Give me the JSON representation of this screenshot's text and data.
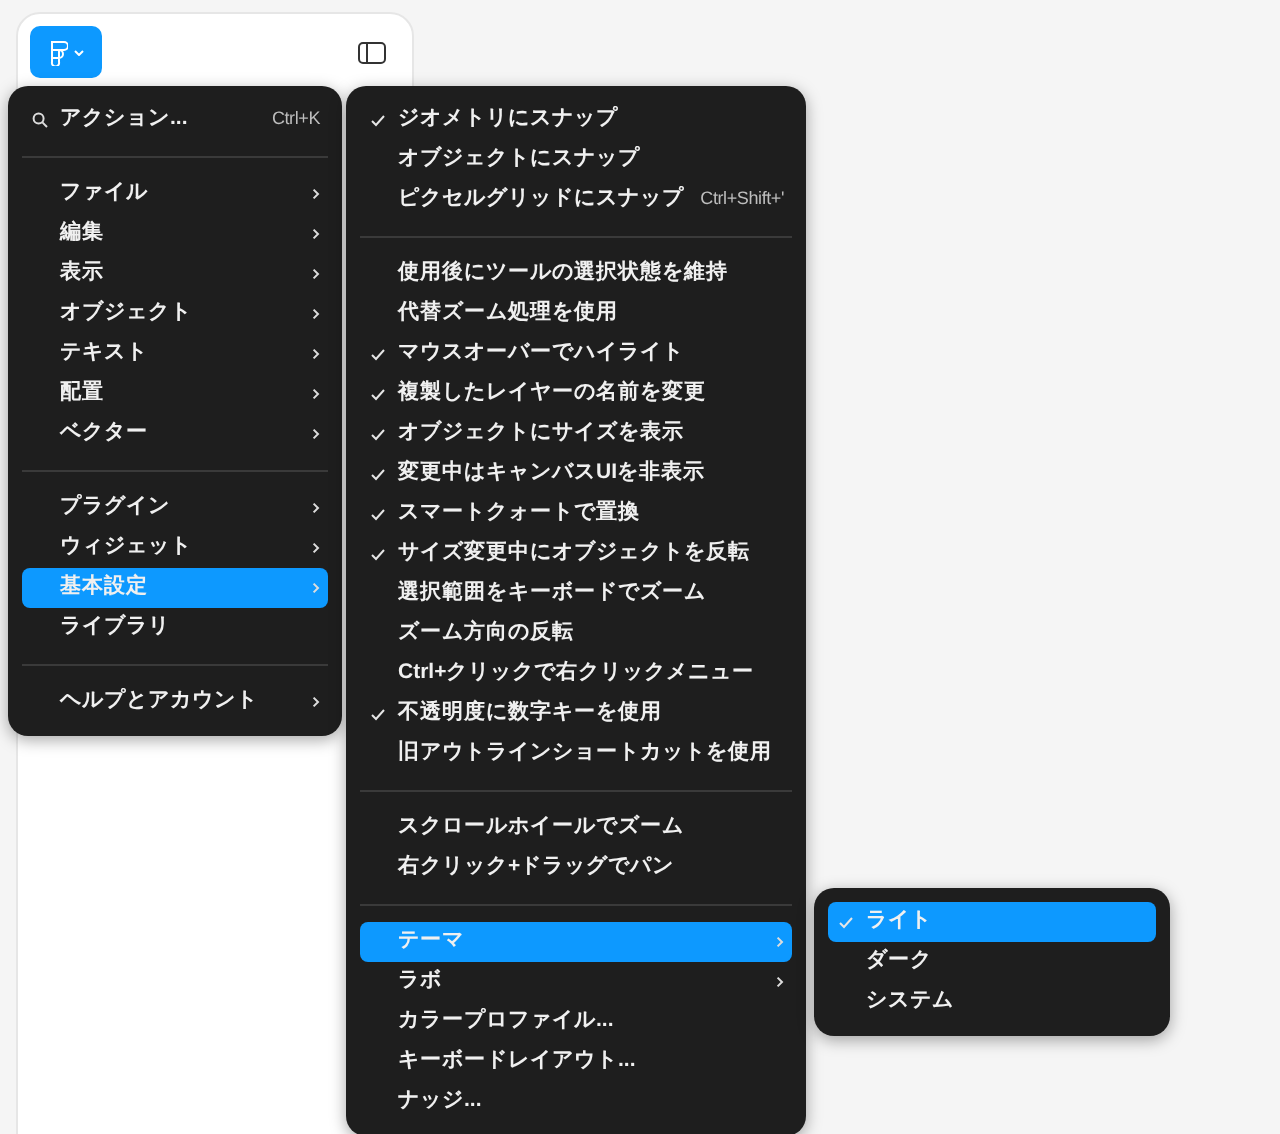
{
  "main_menu": {
    "sections": [
      {
        "items": [
          {
            "kind": "search",
            "label": "アクション...",
            "shortcut": "Ctrl+K",
            "has_submenu": false,
            "selected": false
          }
        ]
      },
      {
        "items": [
          {
            "kind": "item",
            "label": "ファイル",
            "has_submenu": true,
            "selected": false
          },
          {
            "kind": "item",
            "label": "編集",
            "has_submenu": true,
            "selected": false
          },
          {
            "kind": "item",
            "label": "表示",
            "has_submenu": true,
            "selected": false
          },
          {
            "kind": "item",
            "label": "オブジェクト",
            "has_submenu": true,
            "selected": false
          },
          {
            "kind": "item",
            "label": "テキスト",
            "has_submenu": true,
            "selected": false
          },
          {
            "kind": "item",
            "label": "配置",
            "has_submenu": true,
            "selected": false
          },
          {
            "kind": "item",
            "label": "ベクター",
            "has_submenu": true,
            "selected": false
          }
        ]
      },
      {
        "items": [
          {
            "kind": "item",
            "label": "プラグイン",
            "has_submenu": true,
            "selected": false
          },
          {
            "kind": "item",
            "label": "ウィジェット",
            "has_submenu": true,
            "selected": false
          },
          {
            "kind": "item",
            "label": "基本設定",
            "has_submenu": true,
            "selected": true
          },
          {
            "kind": "item",
            "label": "ライブラリ",
            "has_submenu": false,
            "selected": false
          }
        ]
      },
      {
        "items": [
          {
            "kind": "item",
            "label": "ヘルプとアカウント",
            "has_submenu": true,
            "selected": false
          }
        ]
      }
    ]
  },
  "preferences_menu": {
    "sections": [
      {
        "items": [
          {
            "label": "ジオメトリにスナップ",
            "checked": true,
            "has_submenu": false,
            "selected": false
          },
          {
            "label": "オブジェクトにスナップ",
            "checked": false,
            "has_submenu": false,
            "selected": false
          },
          {
            "label": "ピクセルグリッドにスナップ",
            "shortcut": "Ctrl+Shift+'",
            "checked": false,
            "has_submenu": false,
            "selected": false
          }
        ]
      },
      {
        "items": [
          {
            "label": "使用後にツールの選択状態を維持",
            "checked": false,
            "has_submenu": false,
            "selected": false
          },
          {
            "label": "代替ズーム処理を使用",
            "checked": false,
            "has_submenu": false,
            "selected": false
          },
          {
            "label": "マウスオーバーでハイライト",
            "checked": true,
            "has_submenu": false,
            "selected": false
          },
          {
            "label": "複製したレイヤーの名前を変更",
            "checked": true,
            "has_submenu": false,
            "selected": false
          },
          {
            "label": "オブジェクトにサイズを表示",
            "checked": true,
            "has_submenu": false,
            "selected": false
          },
          {
            "label": "変更中はキャンバスUIを非表示",
            "checked": true,
            "has_submenu": false,
            "selected": false
          },
          {
            "label": "スマートクォートで置換",
            "checked": true,
            "has_submenu": false,
            "selected": false
          },
          {
            "label": "サイズ変更中にオブジェクトを反転",
            "checked": true,
            "has_submenu": false,
            "selected": false
          },
          {
            "label": "選択範囲をキーボードでズーム",
            "checked": false,
            "has_submenu": false,
            "selected": false
          },
          {
            "label": "ズーム方向の反転",
            "checked": false,
            "has_submenu": false,
            "selected": false
          },
          {
            "label": "Ctrl+クリックで右クリックメニュー",
            "checked": false,
            "has_submenu": false,
            "selected": false
          },
          {
            "label": "不透明度に数字キーを使用",
            "checked": true,
            "has_submenu": false,
            "selected": false
          },
          {
            "label": "旧アウトラインショートカットを使用",
            "checked": false,
            "has_submenu": false,
            "selected": false
          }
        ]
      },
      {
        "items": [
          {
            "label": "スクロールホイールでズーム",
            "checked": false,
            "has_submenu": false,
            "selected": false
          },
          {
            "label": "右クリック+ドラッグでパン",
            "checked": false,
            "has_submenu": false,
            "selected": false
          }
        ]
      },
      {
        "items": [
          {
            "label": "テーマ",
            "checked": false,
            "has_submenu": true,
            "selected": true
          },
          {
            "label": "ラボ",
            "checked": false,
            "has_submenu": true,
            "selected": false
          },
          {
            "label": "カラープロファイル...",
            "checked": false,
            "has_submenu": false,
            "selected": false
          },
          {
            "label": "キーボードレイアウト...",
            "checked": false,
            "has_submenu": false,
            "selected": false
          },
          {
            "label": "ナッジ...",
            "checked": false,
            "has_submenu": false,
            "selected": false
          }
        ]
      }
    ]
  },
  "theme_menu": {
    "sections": [
      {
        "items": [
          {
            "label": "ライト",
            "checked": true,
            "has_submenu": false,
            "selected": true
          },
          {
            "label": "ダーク",
            "checked": false,
            "has_submenu": false,
            "selected": false
          },
          {
            "label": "システム",
            "checked": false,
            "has_submenu": false,
            "selected": false
          }
        ]
      }
    ]
  }
}
